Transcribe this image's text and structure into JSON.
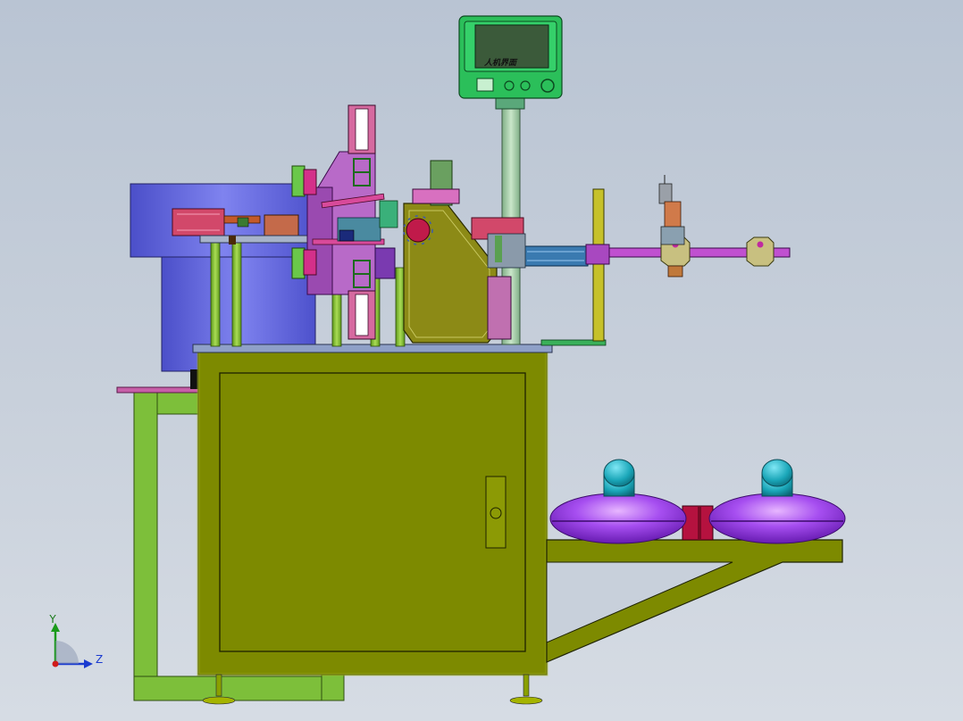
{
  "hmi": {
    "screen_label": "人机界面"
  },
  "triad": {
    "y_label": "Y",
    "z_label": "Z"
  },
  "colors": {
    "cabinet": "#7d8a00",
    "cabinet_frame": "#a3b01a",
    "leg_frame": "#7dbf3a",
    "bowl": "#5a5fd6",
    "hmi": "#2bbf5a",
    "reel": "#9a3ee0",
    "reel_cap": "#1aa6b8"
  }
}
